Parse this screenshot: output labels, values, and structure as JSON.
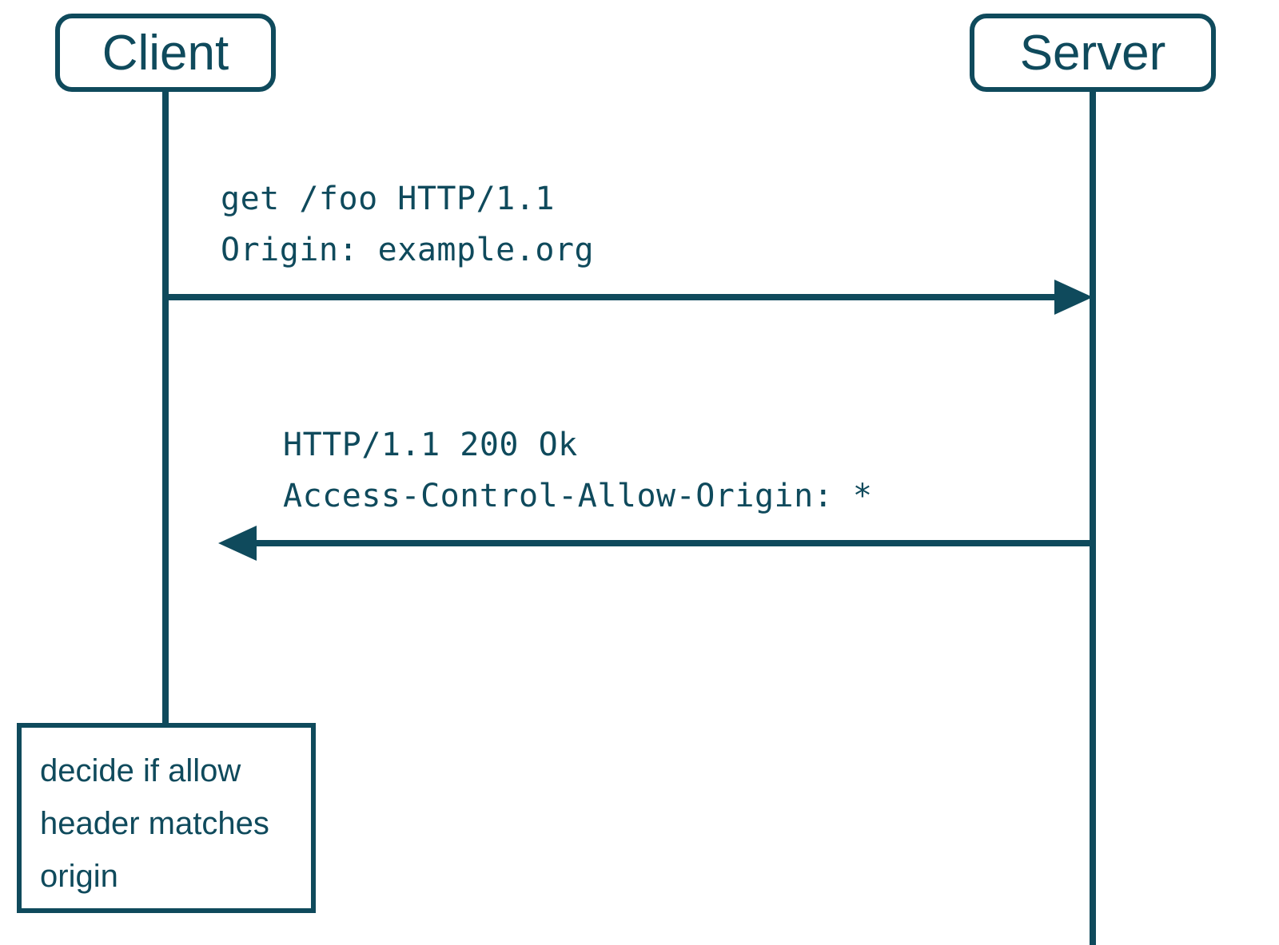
{
  "actors": {
    "client": "Client",
    "server": "Server"
  },
  "messages": {
    "request": {
      "line1": "get /foo HTTP/1.1",
      "line2": "Origin: example.org"
    },
    "response": {
      "line1": "HTTP/1.1 200 Ok",
      "line2": "Access-Control-Allow-Origin: *"
    }
  },
  "note": {
    "line1": "decide if allow",
    "line2": "header matches",
    "line3": "origin"
  },
  "colors": {
    "primary": "#0f4a5c"
  }
}
